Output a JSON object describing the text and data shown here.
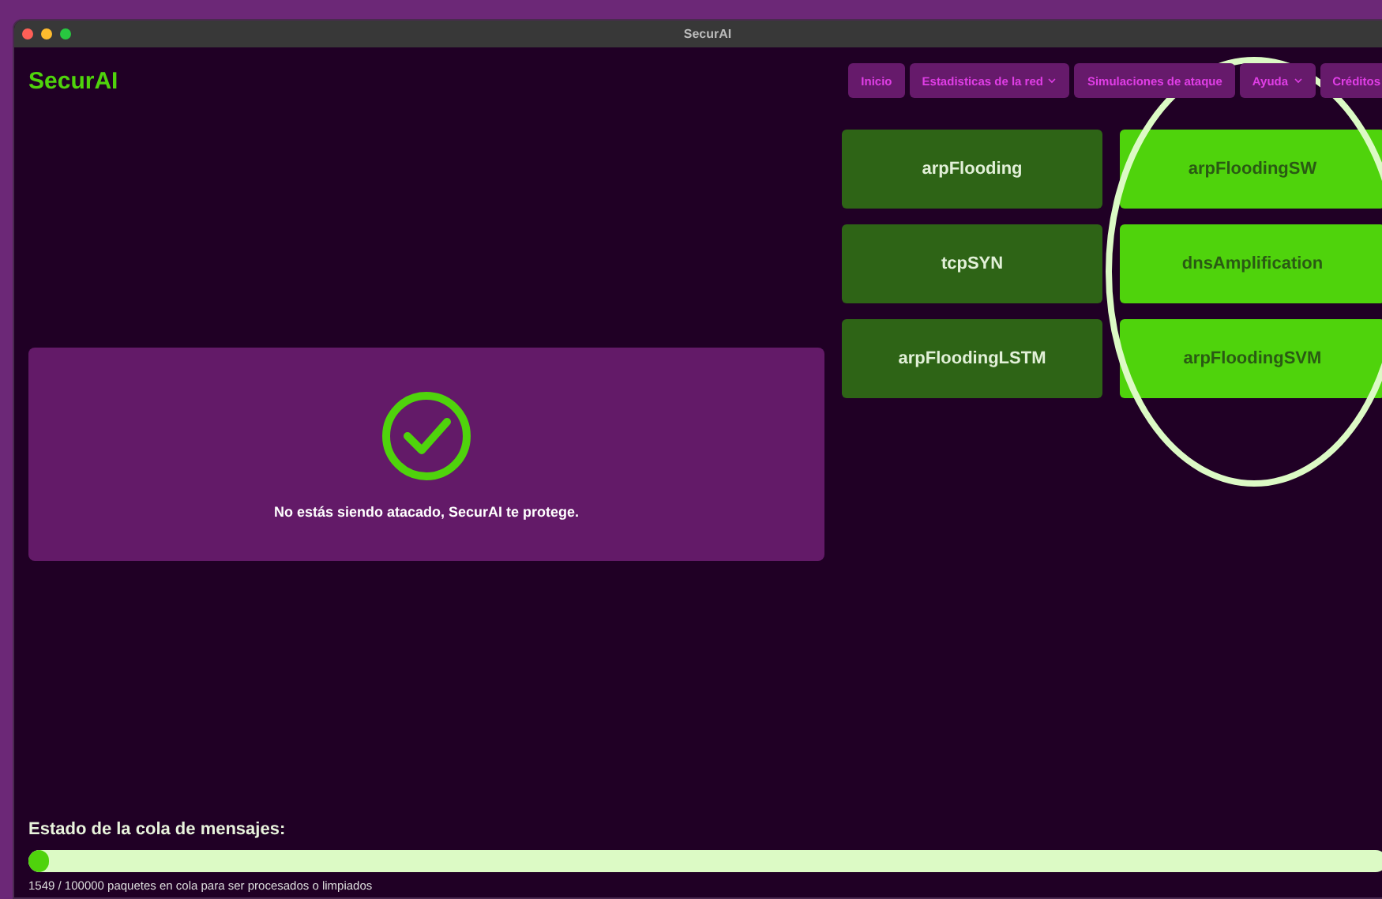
{
  "window": {
    "title": "SecurAI"
  },
  "app": {
    "logo": "SecurAI"
  },
  "nav": [
    {
      "label": "Inicio",
      "dropdown": false
    },
    {
      "label": "Estadisticas de la red",
      "dropdown": true
    },
    {
      "label": "Simulaciones de ataque",
      "dropdown": false
    },
    {
      "label": "Ayuda",
      "dropdown": true
    },
    {
      "label": "Créditos",
      "dropdown": false
    }
  ],
  "models": [
    {
      "name": "arpFlooding",
      "active": false
    },
    {
      "name": "arpFloodingSW",
      "active": true
    },
    {
      "name": "tcpSYN",
      "active": false
    },
    {
      "name": "dnsAmplification",
      "active": true
    },
    {
      "name": "arpFloodingLSTM",
      "active": false
    },
    {
      "name": "arpFloodingSVM",
      "active": true
    }
  ],
  "status": {
    "message": "No estás siendo atacado, SecurAI te protege.",
    "attacked": false
  },
  "queue": {
    "title": "Estado de la cola de mensajes:",
    "level": 0.0155,
    "caption": "1549 / 100000 paquetes en cola para ser procesados o limpiados"
  },
  "annotation": {
    "kind": "ellipse"
  }
}
